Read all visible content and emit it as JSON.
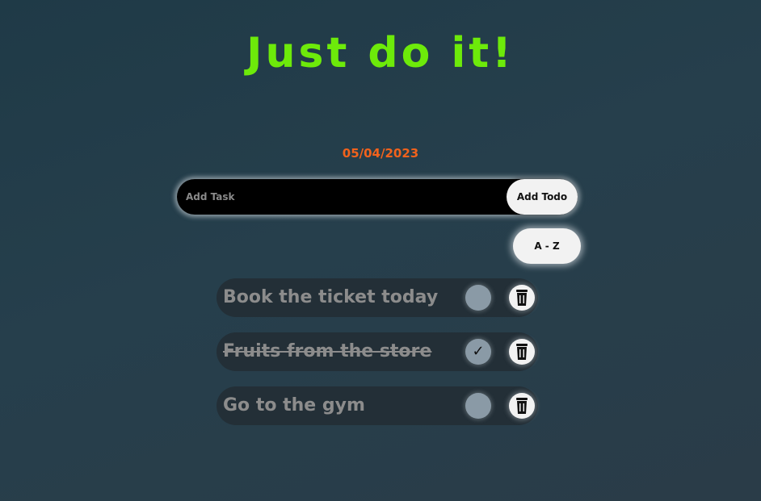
{
  "header": {
    "title": "Just do it!",
    "date": "05/04/2023"
  },
  "add_form": {
    "placeholder": "Add Task",
    "value": "",
    "button_label": "Add Todo"
  },
  "sort": {
    "button_label": "A - Z"
  },
  "todos": [
    {
      "text": "Book the ticket today",
      "done": false
    },
    {
      "text": "Fruits from the store",
      "done": true,
      "check_mark": "✓"
    },
    {
      "text": "Go to the gym",
      "done": false
    }
  ],
  "icons": {
    "delete": "trash-icon"
  },
  "colors": {
    "title": "#6dea0a",
    "date": "#f2621c",
    "background": "#263f4c"
  }
}
